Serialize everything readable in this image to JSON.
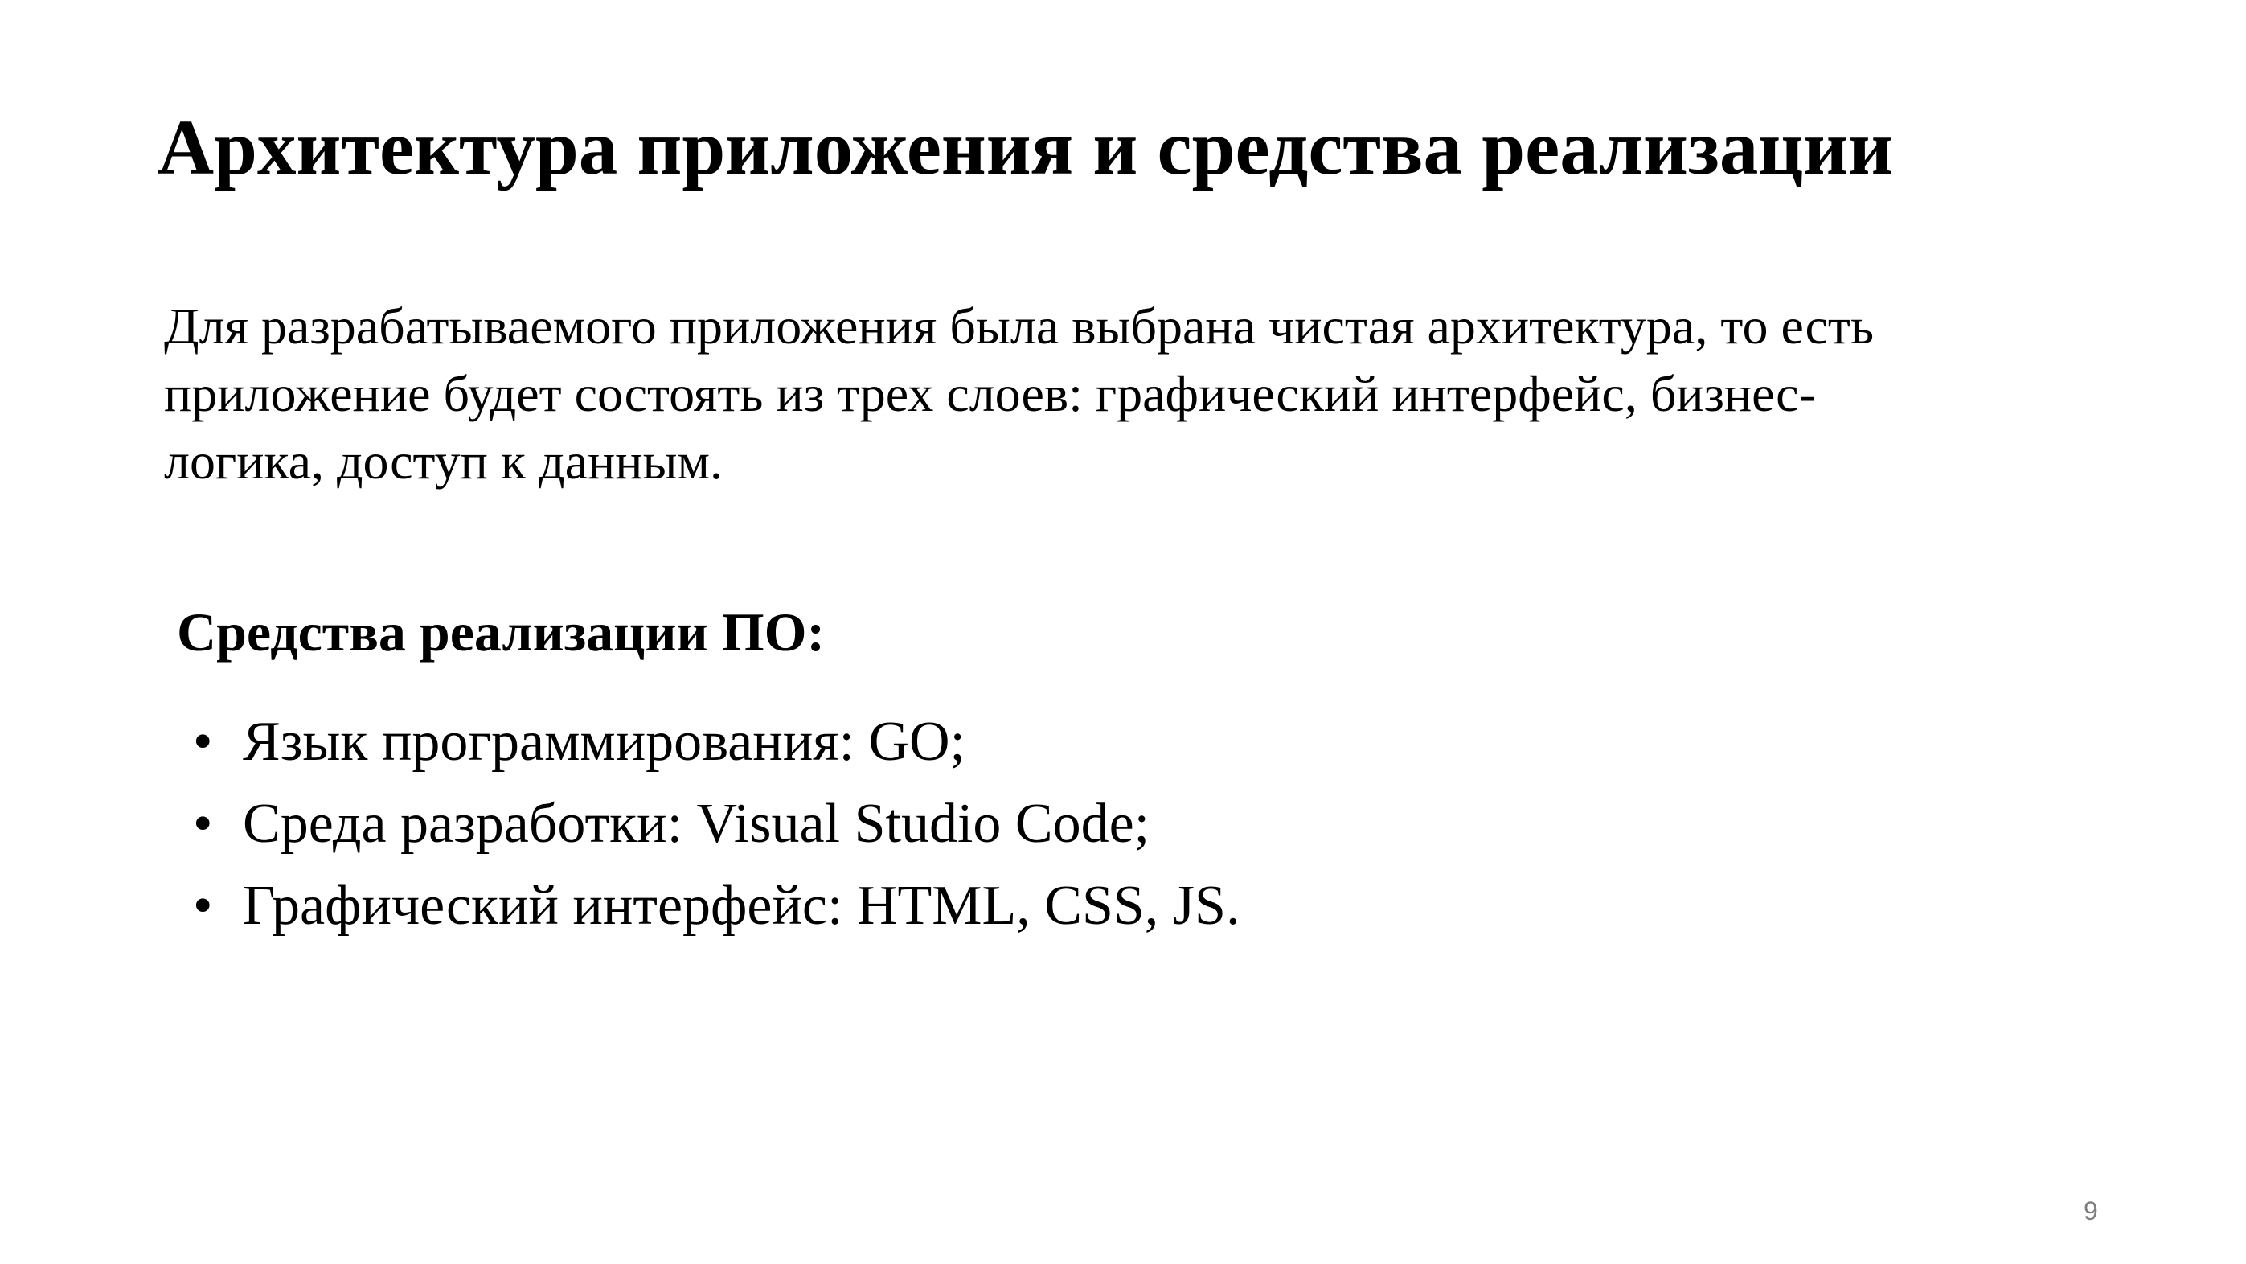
{
  "slide": {
    "title": "Архитектура приложения и средства реализации",
    "intro_lines": [
      "Для разрабатываемого приложения была выбрана чистая архитектура, то есть",
      "приложение будет состоять из трех слоев: графический интерфейс, бизнес-",
      "логика, доступ к данным."
    ],
    "tools_heading": "Средства реализации ПО:",
    "tools": [
      "Язык программирования: GO;",
      "Среда разработки: Visual Studio Code;",
      "Графический интерфейс: HTML, CSS, JS."
    ],
    "bullet_glyph": "•",
    "page_number": "9"
  },
  "colors": {
    "background": "#ffffff",
    "text": "#000000",
    "page_number": "#7f7f7f"
  }
}
